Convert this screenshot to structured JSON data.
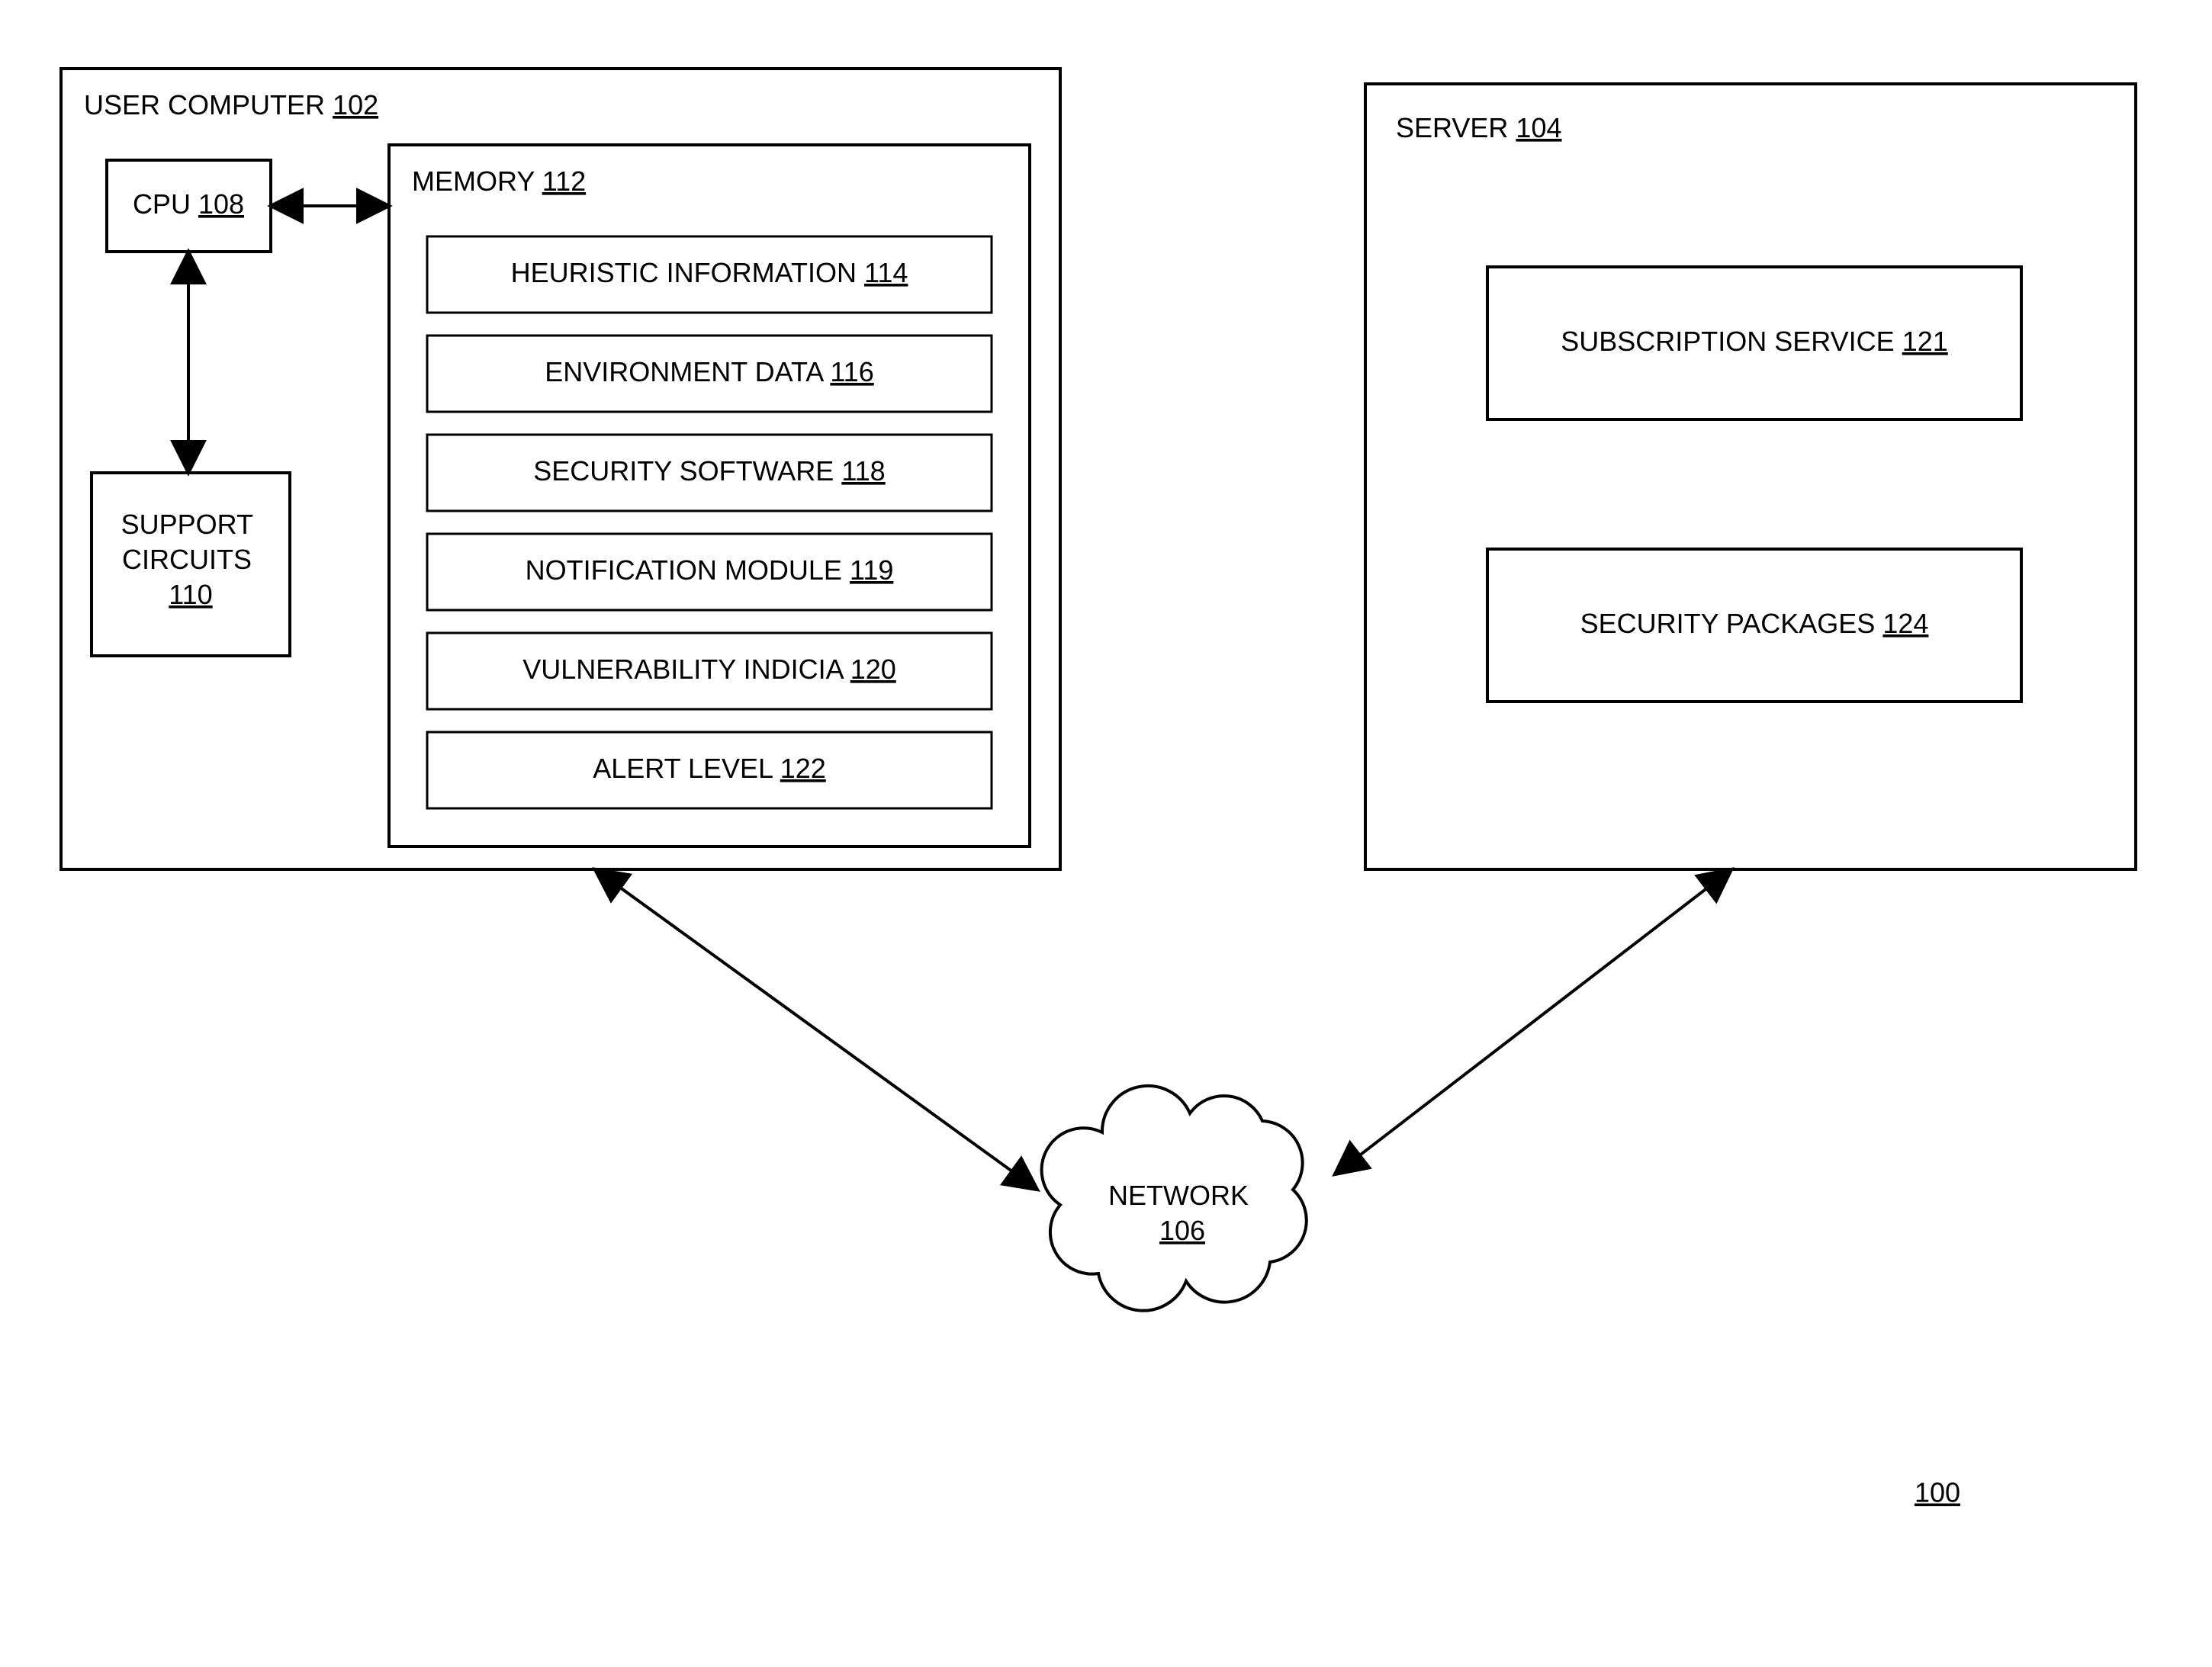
{
  "userComputer": {
    "label": "USER COMPUTER",
    "ref": "102"
  },
  "cpu": {
    "label": "CPU",
    "ref": "108"
  },
  "support": {
    "line1": "SUPPORT",
    "line2": "CIRCUITS",
    "ref": "110"
  },
  "memory": {
    "label": "MEMORY",
    "ref": "112"
  },
  "mem_items": [
    {
      "label": "HEURISTIC INFORMATION",
      "ref": "114"
    },
    {
      "label": "ENVIRONMENT DATA",
      "ref": "116"
    },
    {
      "label": "SECURITY SOFTWARE",
      "ref": "118"
    },
    {
      "label": "NOTIFICATION MODULE",
      "ref": "119"
    },
    {
      "label": "VULNERABILITY INDICIA",
      "ref": "120"
    },
    {
      "label": "ALERT LEVEL",
      "ref": "122"
    }
  ],
  "server": {
    "label": "SERVER",
    "ref": "104"
  },
  "subscription": {
    "label": "SUBSCRIPTION SERVICE",
    "ref": "121"
  },
  "packages": {
    "label": "SECURITY PACKAGES",
    "ref": "124"
  },
  "network": {
    "label": "NETWORK",
    "ref": "106"
  },
  "figure_ref": "100"
}
